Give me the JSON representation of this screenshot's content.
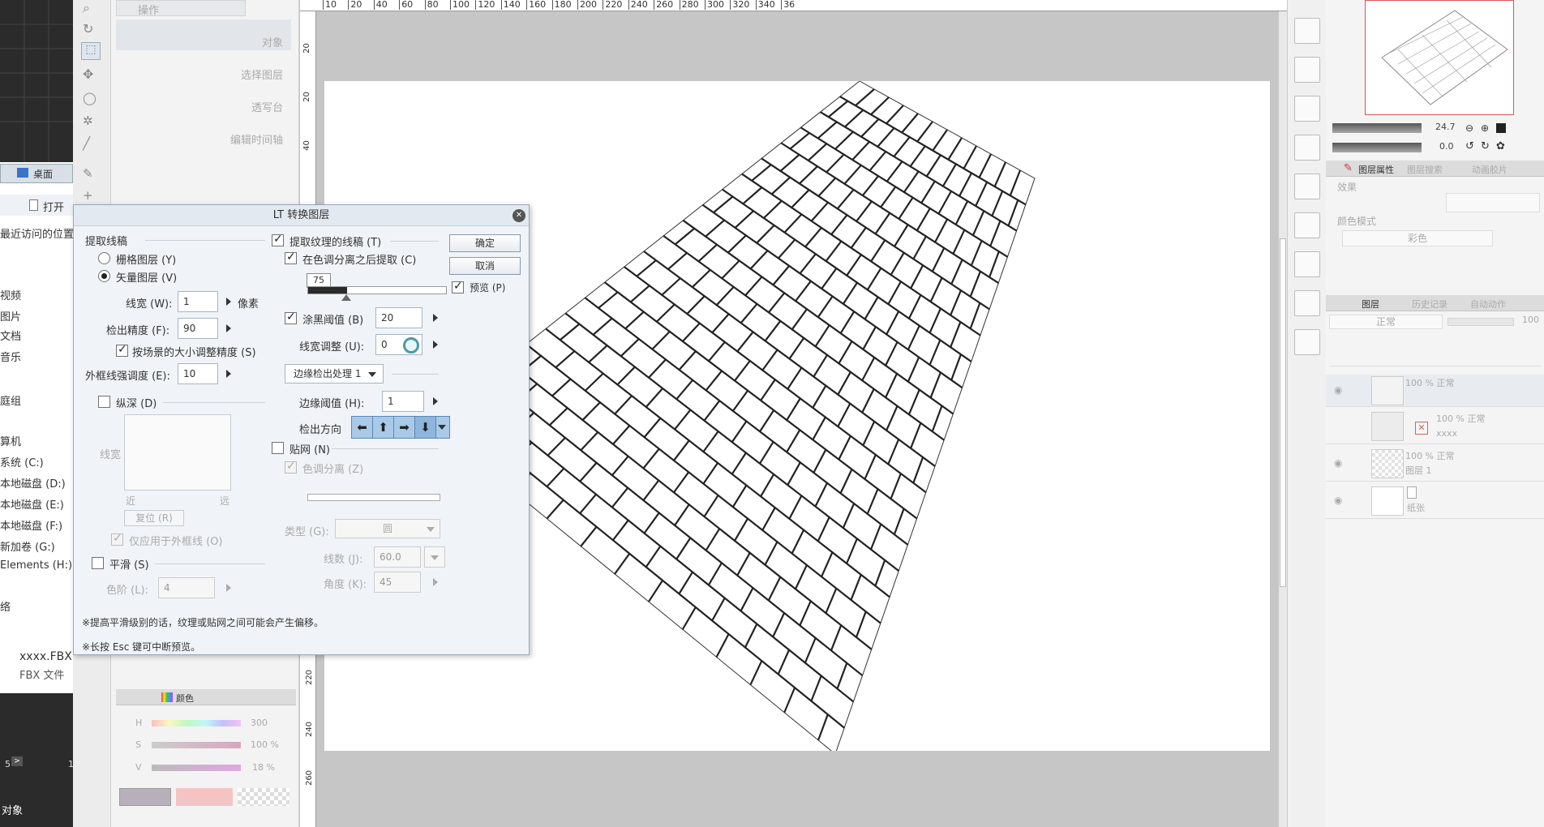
{
  "explorer": {
    "location": "桌面",
    "open_label": "打开",
    "items": [
      "最近访问的位置",
      "视频",
      "图片",
      "文档",
      "音乐",
      "庭组",
      "算机",
      "系统 (C:)",
      "本地磁盘 (D:)",
      "本地磁盘 (E:)",
      "本地磁盘 (F:)",
      "新加卷 (G:)",
      "Elements (H:)",
      "络"
    ],
    "file_name": "xxxx.FBX",
    "file_type": "FBX 文件",
    "bottom_label": "对象",
    "timeline_5": "5",
    "timeline_1": "1"
  },
  "tool_panel": {
    "header": "操作",
    "items": [
      "对象",
      "选择图层",
      "透写台",
      "编辑时间轴"
    ]
  },
  "color_panel": {
    "tab_label": "颜色",
    "h_label": "H",
    "h_value": "300",
    "s_label": "S",
    "s_value": "100",
    "v_label": "V",
    "v_value": "18",
    "pct": "%"
  },
  "ruler": {
    "top_ticks": [
      "10",
      "20",
      "40",
      "60",
      "80",
      "100",
      "120",
      "140",
      "160",
      "180",
      "200",
      "220",
      "240",
      "260",
      "280",
      "300",
      "320",
      "340",
      "36"
    ],
    "left_ticks": [
      "20",
      "20",
      "40",
      "220",
      "240",
      "260"
    ]
  },
  "navigator": {
    "zoom": "24.7",
    "rotation": "0.0"
  },
  "layer_property": {
    "tabs": [
      "图层属性",
      "图层搜索",
      "动画胶片"
    ],
    "effect_label": "效果",
    "color_mode_label": "颜色模式",
    "color_mode_value": "彩色"
  },
  "layers": {
    "tabs": [
      "图层",
      "历史记录",
      "自动动作"
    ],
    "blend_mode": "正常",
    "opacity": "100",
    "rows": [
      {
        "line1": "100 % 正常",
        "line2": ""
      },
      {
        "line1": "100 % 正常",
        "line2": "xxxx"
      },
      {
        "line1": "100 % 正常",
        "line2": "图层 1"
      },
      {
        "line1": "",
        "line2": "纸张"
      }
    ]
  },
  "dialog": {
    "title": "LT 转换图层",
    "extract_lines_label": "提取线稿",
    "raster_label": "栅格图层 (Y)",
    "vector_label": "矢量图层 (V)",
    "line_width_label": "线宽 (W):",
    "line_width_value": "1",
    "unit_label": "像素",
    "precision_label": "检出精度 (F):",
    "precision_value": "90",
    "scale_label": "按场景的大小调整精度 (S)",
    "outline_label": "外框线强调度 (E):",
    "outline_value": "10",
    "depth_label": "纵深 (D)",
    "depth_lw_label": "线宽",
    "near_label": "近",
    "far_label": "远",
    "reset_label": "复位 (R)",
    "outer_only_label": "仅应用于外框线 (O)",
    "smooth_label": "平滑 (S)",
    "levels_label": "色阶 (L):",
    "levels_value": "4",
    "texture_lines_label": "提取纹理的线稿 (T)",
    "after_sep_label": "在色调分离之后提取 (C)",
    "slider_value": 75,
    "slider_label": "75",
    "black_threshold_label": "涂黑阈值 (B)",
    "black_threshold_value": "20",
    "lw_adjust_label": "线宽调整 (U):",
    "lw_adjust_value": "0",
    "edge_process_label": "边缘检出处理 1",
    "edge_threshold_label": "边缘阈值 (H):",
    "edge_threshold_value": "1",
    "direction_label": "检出方向",
    "tone_label": "贴网 (N)",
    "posterize_label": "色调分离 (Z)",
    "type_label": "类型 (G):",
    "type_value": "圆",
    "lines_label": "线数 (J):",
    "lines_value": "60.0",
    "angle_label": "角度 (K):",
    "angle_value": "45",
    "ok_label": "确定",
    "cancel_label": "取消",
    "preview_label": "预览 (P)",
    "note1": "※提高平滑级别的话，纹理或贴网之间可能会产生偏移。",
    "note2": "※长按 Esc 键可中断预览。"
  }
}
